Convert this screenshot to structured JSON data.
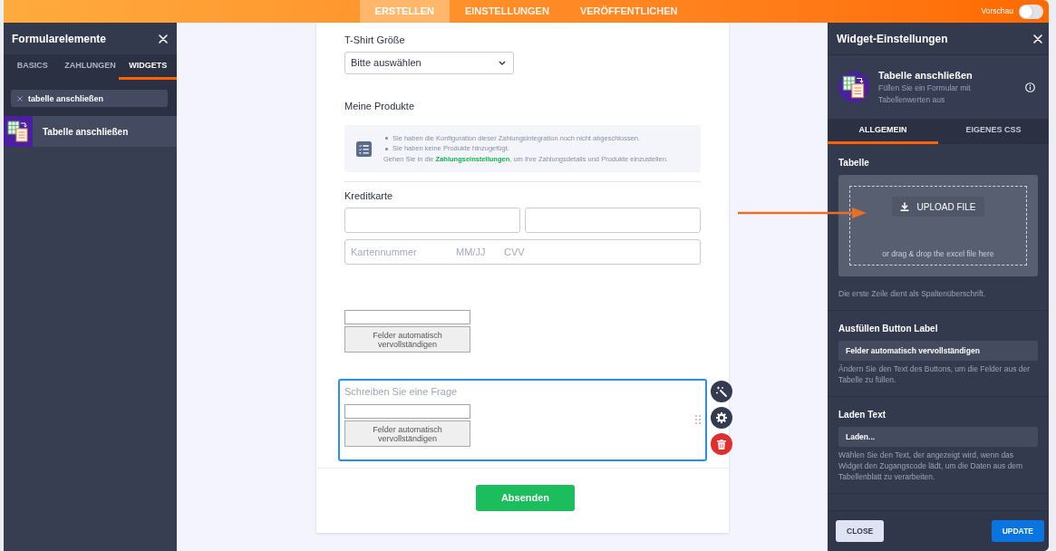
{
  "top_bar": {
    "tabs": [
      {
        "label": "ERSTELLEN",
        "selected": true
      },
      {
        "label": "EINSTELLUNGEN",
        "selected": false
      },
      {
        "label": "VERÖFFENTLICHEN",
        "selected": false
      }
    ],
    "preview": {
      "label": "Vorschau",
      "on": false
    }
  },
  "elements_panel": {
    "title": "Formularelemente",
    "tabs": [
      {
        "label": "BASICS",
        "selected": false
      },
      {
        "label": "ZAHLUNGEN",
        "selected": false
      },
      {
        "label": "WIDGETS",
        "selected": true
      }
    ],
    "search": {
      "value": "tabelle anschließen"
    },
    "results": [
      {
        "label": "Tabelle anschließen"
      }
    ]
  },
  "form": {
    "fields": [
      {
        "kind": "dropdown",
        "label": "T-Shirt Größe",
        "value": "Bitte auswählen"
      },
      {
        "kind": "products",
        "label": "Meine Produkte",
        "notices": [
          "Sie haben die Konfiguration dieser Zahlungsintegration noch nicht abgeschlossen.",
          "Sie haben keine Produkte hinzugefügt."
        ],
        "hint": {
          "before": "Gehen Sie in die ",
          "link": "Zahlungseinstellungen",
          "after": ", um Ihre Zahlungsdetails und Produkte einzustellen."
        }
      },
      {
        "kind": "credit_card",
        "label": "Kreditkarte",
        "placeholders": [
          "Kartennummer",
          "MM/JJ",
          "CVV"
        ]
      },
      {
        "kind": "table_widget",
        "button": "Felder automatisch vervollständigen",
        "selected": false
      },
      {
        "kind": "table_widget",
        "placeholder": "Schreiben Sie eine Frage",
        "button": "Felder automatisch vervollständigen",
        "selected": true
      }
    ],
    "submit": "Absenden"
  },
  "widget_settings": {
    "title": "Widget-Einstellungen",
    "widget": {
      "name": "Tabelle anschließen",
      "description": "Füllen Sie ein Formular mit Tabellenwerten aus"
    },
    "tabs": [
      {
        "label": "ALLGEMEIN",
        "selected": true
      },
      {
        "label": "EIGENES CSS",
        "selected": false
      }
    ],
    "sections": [
      {
        "kind": "upload",
        "heading": "Tabelle",
        "button": "UPLOAD FILE",
        "drop_hint": "or drag & drop the excel file here",
        "help": "Die erste Zeile dient als Spaltenüberschrift."
      },
      {
        "kind": "text",
        "heading": "Ausfüllen Button Label",
        "value": "Felder automatisch vervollständigen",
        "help": "Ändern Sie den Text des Buttons, um die Felder aus der Tabelle zu füllen."
      },
      {
        "kind": "text",
        "heading": "Laden Text",
        "value": "Laden...",
        "help": "Wählen Sie den Text, der angezeigt wird, wenn das Widget den Zugangscode lädt, um die Daten aus dem Tabellenblatt zu verarbeiten."
      }
    ],
    "buttons": [
      {
        "label": "CLOSE",
        "kind": "secondary"
      },
      {
        "label": "UPDATE",
        "kind": "primary"
      }
    ]
  }
}
